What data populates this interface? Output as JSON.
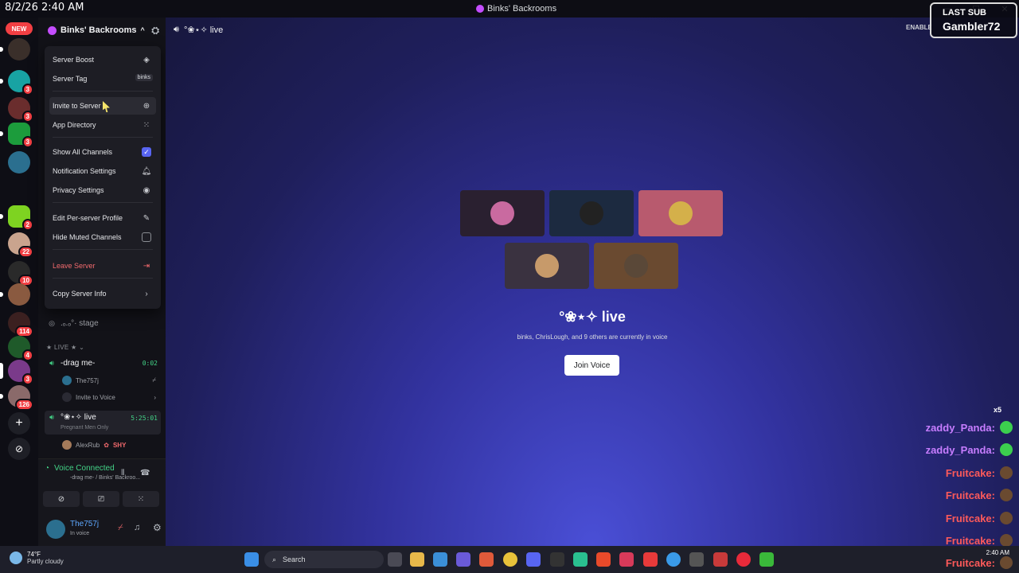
{
  "os": {
    "timestamp": "8/2/26 2:40 AM",
    "tray_time": "2:40 AM",
    "weather_temp": "74°F",
    "weather_desc": "Partly cloudy",
    "search_placeholder": "Search"
  },
  "window": {
    "title": "Binks' Backrooms",
    "minimize": "—",
    "maximize": "☐",
    "close": "✕"
  },
  "guilds": {
    "new_badge": "NEW",
    "badges": [
      "3",
      "3",
      "3",
      "2",
      "22",
      "10",
      "114",
      "4",
      "3",
      "126"
    ]
  },
  "server": {
    "name": "Binks' Backrooms"
  },
  "menu": {
    "items": [
      {
        "label": "Server Boost"
      },
      {
        "label": "Server Tag",
        "pill": "binks"
      },
      {
        "label": "Invite to Server"
      },
      {
        "label": "App Directory"
      },
      {
        "label": "Show All Channels"
      },
      {
        "label": "Notification Settings"
      },
      {
        "label": "Privacy Settings"
      },
      {
        "label": "Edit Per-server Profile"
      },
      {
        "label": "Hide Muted Channels"
      },
      {
        "label": "Leave Server"
      },
      {
        "label": "Copy Server Info"
      }
    ]
  },
  "channels": {
    "stage": ".ₒ.ₒ°· stage",
    "category_live": "★ LIVE ★",
    "drag": {
      "name": "-drag me-",
      "time": "0:02"
    },
    "drag_member": "The757j",
    "invite_voice": "Invite to Voice",
    "live": {
      "name": "°❀⋆✧ live",
      "time": "5:25:01",
      "sub": "Pregnant Men Only"
    },
    "live_member": "AlexRub",
    "live_member_tag": "SHY"
  },
  "voice_panel": {
    "status": "Voice Connected",
    "sub": "-drag me- / Binks' Backroo...",
    "username": "The757j",
    "user_status": "In voice"
  },
  "main": {
    "header": "°❀⋆✧ live",
    "channel_title": "°❀⋆✧ live",
    "description": "binks, ChrisLough, and 9 others are currently in voice",
    "join_label": "Join Voice"
  },
  "overlay": {
    "last_sub_label": "LAST SUB",
    "last_sub_name": "Gambler72",
    "enable_text": "ENABLE",
    "emote_count": "x5",
    "chat": [
      {
        "user": "zaddy_Panda:",
        "color": "#c77dff"
      },
      {
        "user": "zaddy_Panda:",
        "color": "#c77dff"
      },
      {
        "user": "Fruitcake:",
        "color": "#ff5a5a"
      },
      {
        "user": "Fruitcake:",
        "color": "#ff5a5a"
      },
      {
        "user": "Fruitcake:",
        "color": "#ff5a5a"
      },
      {
        "user": "Fruitcake:",
        "color": "#ff5a5a"
      },
      {
        "user": "Fruitcake:",
        "color": "#ff5a5a"
      }
    ]
  },
  "colors": {
    "accent": "#5865f2",
    "voice_green": "#43d387",
    "danger": "#f26a6d"
  }
}
